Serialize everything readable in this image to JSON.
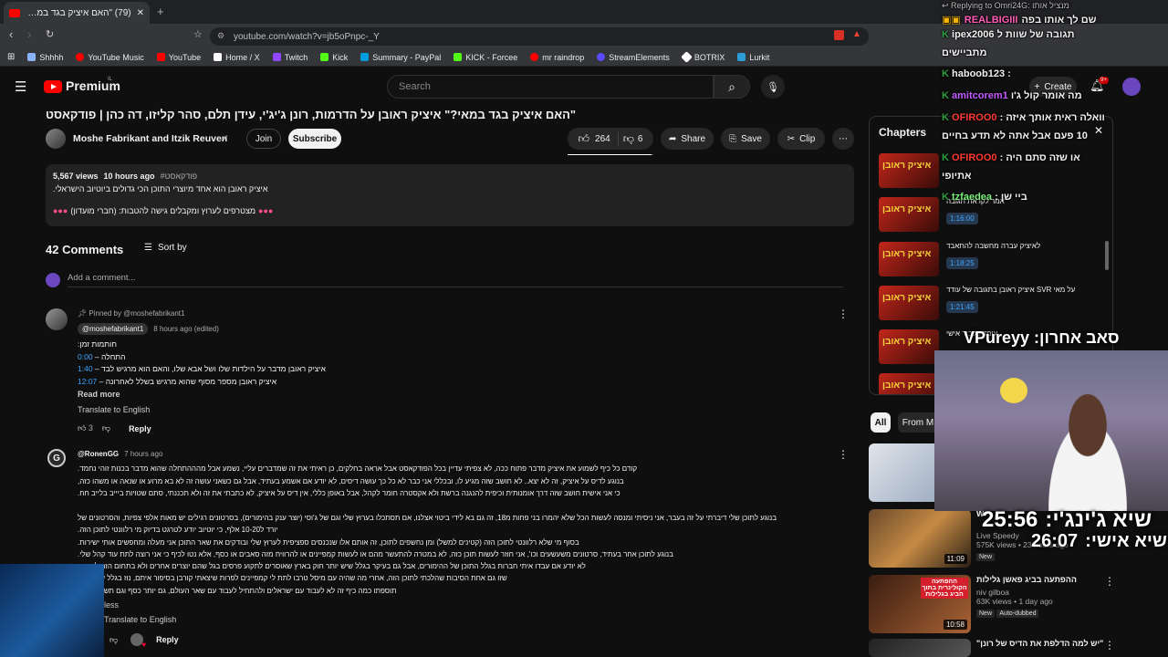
{
  "browser": {
    "tab_title": "(79) \"האם איציק בגד במאי?\" איציק",
    "url": "youtube.com/watch?v=jb5oPnpc-_Y",
    "bookmarks": [
      "Shhhh",
      "YouTube Music",
      "YouTube",
      "Home / X",
      "Twitch",
      "Kick",
      "Summary - PayPal",
      "KICK - Forcee",
      "mr raindrop",
      "StreamElements",
      "BOTRIX",
      "Lurkit"
    ]
  },
  "header": {
    "logo": "Premium",
    "logo_region": "IL",
    "search_placeholder": "Search",
    "create_label": "Create",
    "notif_count": "9+"
  },
  "video": {
    "title": "\"האם איציק בגד במאי?\" איציק ראובן על הדרמות, רונן ג'יג'י, עידן תלם, סהר קליזו, דה כהן | פודקאסט",
    "channel": "Moshe Fabrikant and Itzik Reuven",
    "join": "Join",
    "subscribe": "Subscribe",
    "likes": "264",
    "dislikes": "6",
    "share": "Share",
    "save": "Save",
    "clip": "Clip",
    "views": "5,567 views",
    "age": "10 hours ago",
    "hashtag": "#פודקאסט",
    "desc_line1": "איציק ראובן הוא אחד מיוצרי התוכן הכי גדולים ביוטיוב הישראלי.",
    "desc_line2": "מצטרפים לערוץ ומקבלים גישה להטבות: (חברי מועדון)"
  },
  "comments": {
    "count_label": "42 Comments",
    "sort_label": "Sort by",
    "add_placeholder": "Add a comment...",
    "pinned": {
      "pinned_by": "Pinned by @moshefabrikant1",
      "author": "@moshefabrikant1",
      "age": "8 hours ago (edited)",
      "lines": [
        "חותמות זמן:",
        "התחלה – ",
        "איציק ראובן מדבר על הילדות שלו ושל אבא שלו, והאם הוא מרגיש לבד – ",
        "איציק ראובן מספר מסוף שהוא מרגיש בשלל לאחרונה – "
      ],
      "timestamps": [
        "0:00",
        "1:40",
        "12:07"
      ],
      "read_more": "Read more",
      "translate": "Translate to English",
      "likes": "3",
      "reply": "Reply"
    },
    "second": {
      "author": "@RonenGG",
      "age": "7 hours ago",
      "para1": [
        "קודם כל כיף לשמוע את איציק מדבר פתוח ככה, לא צפיתי עדיין בכל הפודקאסט אבל אראה בחלקים, כן ראיתי את זה שמדברים עליי, נשמע אבל מהההתחלה שהוא מדבר בכנות זוהי נחמד.",
        "בנוגע לדיס על איציק, זה לא יצא.. לא חושב שזה מגיע לו, ובכללי אני כבר לא כל כך עושה דיסים, לא יודע אם אשמע בעתיד, אבל גם כשאני עושה זה לא בא מרוע או שנאה או משהו כזה,",
        "כי אני אישית חושב שזה דרך אומנותית וכיפית להנגנה ברשת ולא אקסטרה חומר לקהל, אבל באופן כללי, אין דיס על איציק, לא כתבתי את זה ולא תכננתי, סתם שטויות ביייב בלייב חח."
      ],
      "para2": [
        "בנוגע לתוכן שלי דיברתי על זה בעבר, אני ניסיתי ומנסה לעשות הכל שלא יהמרו בני פחות מ18, זה גם בא לידי ביטוי אצלנו, אם תסתכלו בערוץ שלי וגם של ג'וסי (יוצר ענק בהימורים), בסרטונים רגילים יש מאות אלפי צפיות, והסרטונים של",
        "יורד ל10-20 אלף, כי יוטיוב יודע לטרגט בדיוק מי רלוונטי לתוכן הזה.",
        "בסוף מי שלא רלוונטי לתוכן הזה (קטינים למשל) ומן נחשפים לתוכן, זה אותם אלו שנכנסים ספציפית לערוץ שלי ובודקים את שאר התוכן אני מעלה ומחפשים אותי ישירות.",
        "בנוגע לתוכן אחר בעתיד, סרטונים משעשעים וכו', אני חוזר לעשות תוכן כזה, לא במטרה להתעשר מהם או לעשות קמפיינים או להרוויח מזה סאבים או כסף, אלא נטו לכיף כי אני רוצה לתת עוד קהל שלי.",
        "לא יודע אם עבדו איתי חברות בגלל התוכן של ההימורים, אבל גם בעיקר בגלל שיש יותר חוק בארץ שאוסרים לתקוע פרסים בגל שהם יוצרים אחרים ולא בתחום הזה לדעתי.",
        "שזו גם אחת הסיבות שהלכתי לתוכן הזה, אחרי מה שהיה עם מיסל טרבו לתת לי קמפיינים לפרות שיצאתי קורבן בסיפור איתם, נוז בגלל שיש לפה",
        "תוספתו כמה כיף זה לא לעבוד עם ישראלים ולהתחיל לעבוד עם שאר העולם, גם יותר כסף וגם תשלום בזמן"
      ],
      "read_less": "less",
      "translate": "Translate to English",
      "reply": "Reply"
    }
  },
  "chapters": {
    "title": "Chapters",
    "items": [
      {
        "label": "",
        "time": ""
      },
      {
        "label": "אמר לקראת תגובה",
        "time": "1:16:00"
      },
      {
        "label": "לאיציק עברה מחשבה להתאבד",
        "time": "1:18:25"
      },
      {
        "label": "על מאי SVR איציק ראובן בתגובה של עודד",
        "time": "1:21:45"
      },
      {
        "label": "עומד בכבוד אישי",
        "time": ""
      }
    ],
    "thumb_text": "איציק ראובן"
  },
  "filters": {
    "all": "All",
    "from": "From M"
  },
  "recommendations": [
    {
      "title": "",
      "channel": "",
      "views": "",
      "duration": "",
      "badge": ""
    },
    {
      "title": "W",
      "channel": "Live Speedy",
      "views": "575K views • 23 hours ago",
      "duration": "11:09",
      "badge": "New"
    },
    {
      "title": "ההפתעה בביג פאשן גלילות",
      "channel": "niv gilboa",
      "views": "63K views • 1 day ago",
      "duration": "10:58",
      "badge": "New",
      "badge2": "Auto-dubbed",
      "thumb_caption": "ההפתעה הקולינרית בתוך הביג בגלילות"
    },
    {
      "title": "\"יש למה הדלפת את הדיס של רונן\"",
      "channel": "",
      "views": "",
      "duration": "",
      "badge": ""
    }
  ],
  "stream_overlay": {
    "reply_to": "Replying to Omri24G: מנציל אותו",
    "pinned_text": "שם לך אותו בפה",
    "pinned_user": "REALBIGIII",
    "lines": [
      {
        "user": "ipex2006",
        "text": "תגובה של שוות ל",
        "color": "#ffffff"
      },
      {
        "user": "",
        "text": "מתביישים",
        "color": "#ffffff"
      },
      {
        "user": "haboob123",
        "text": "",
        "color": "#ffffff"
      },
      {
        "user": "amitcorem1",
        "text": "מה אומר קול ג'ו",
        "color": "#c45cff"
      },
      {
        "user": "OFIROO0",
        "text": "וואלה ראית אותך איזה",
        "color": "#ff3b30"
      },
      {
        "user": "",
        "text": "10 פעם אבל אתה לא תדע בחיים",
        "color": "#ffffff"
      },
      {
        "user": "OFIROO0",
        "text": "או שזה סתם היה",
        "color": "#ff3b30"
      },
      {
        "user": "",
        "text": "אתיופי",
        "color": "#ffffff"
      },
      {
        "user": "tzfaedea",
        "text": "ביי שן",
        "color": "#7cf27c"
      }
    ],
    "cam_label": "סאב אחרון: VPureyy",
    "timer1_label": "שיא ג'ינג'י:",
    "timer1": "25:56",
    "timer2_label": "שיא אישי:",
    "timer2": "26:07"
  },
  "colors": {
    "accent": "#3ea6ff",
    "brand_red": "#ff0000",
    "bg": "#0f0f0f",
    "chat_green": "#2ea043"
  }
}
